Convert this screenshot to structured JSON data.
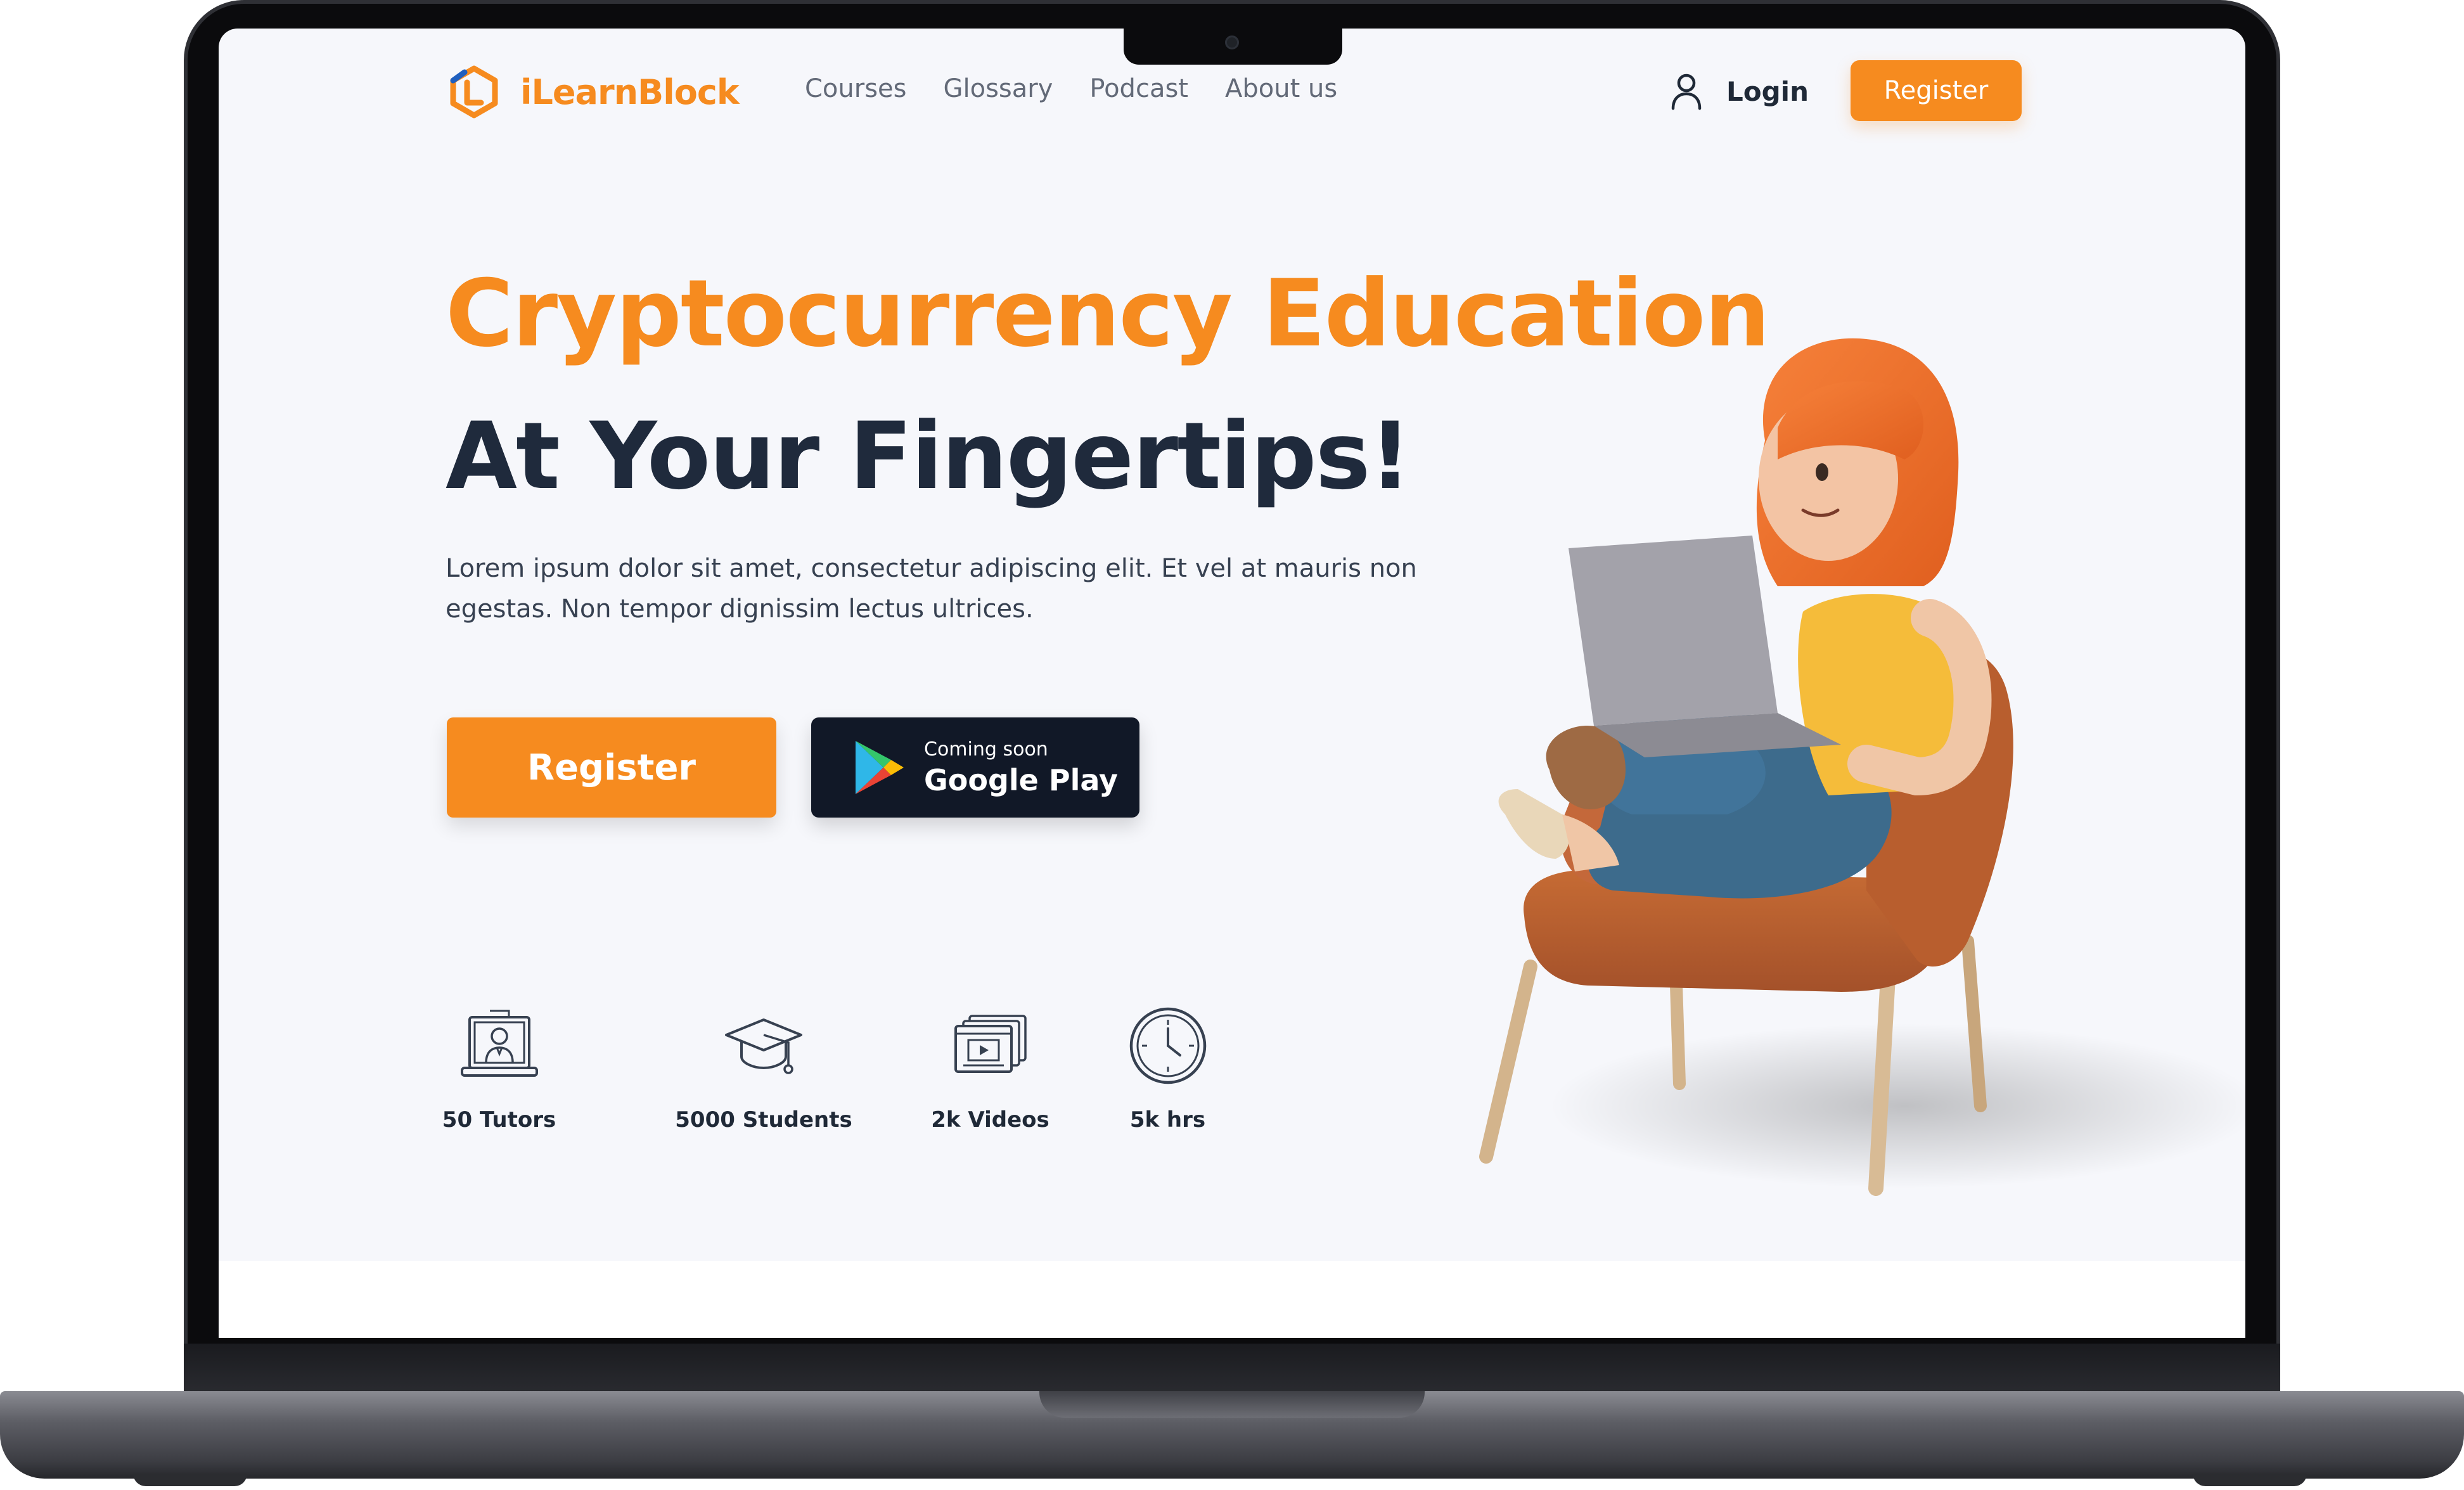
{
  "brand": {
    "name": "iLearnBlock",
    "accent": "#f68b1f",
    "dark": "#1f2a3c"
  },
  "nav": {
    "links": [
      "Courses",
      "Glossary",
      "Podcast",
      "About us"
    ],
    "login_label": "Login",
    "register_label": "Register"
  },
  "hero": {
    "title_line1": "Cryptocurrency Education",
    "title_line2": "At Your Fingertips!",
    "description": "Lorem ipsum dolor sit amet, consectetur adipiscing elit. Et vel at mauris non egestas. Non tempor dignissim lectus ultrices.",
    "register_button": "Register",
    "store_button": {
      "sub": "Coming soon",
      "main": "Google Play"
    }
  },
  "stats": [
    {
      "icon": "tutor-screen-icon",
      "label": "50 Tutors"
    },
    {
      "icon": "graduation-cap-icon",
      "label": "5000 Students"
    },
    {
      "icon": "video-stack-icon",
      "label": "2k Videos"
    },
    {
      "icon": "clock-icon",
      "label": "5k hrs"
    }
  ],
  "icons": {
    "logo": "logo-icon",
    "login": "user-icon",
    "store": "google-play-icon"
  }
}
